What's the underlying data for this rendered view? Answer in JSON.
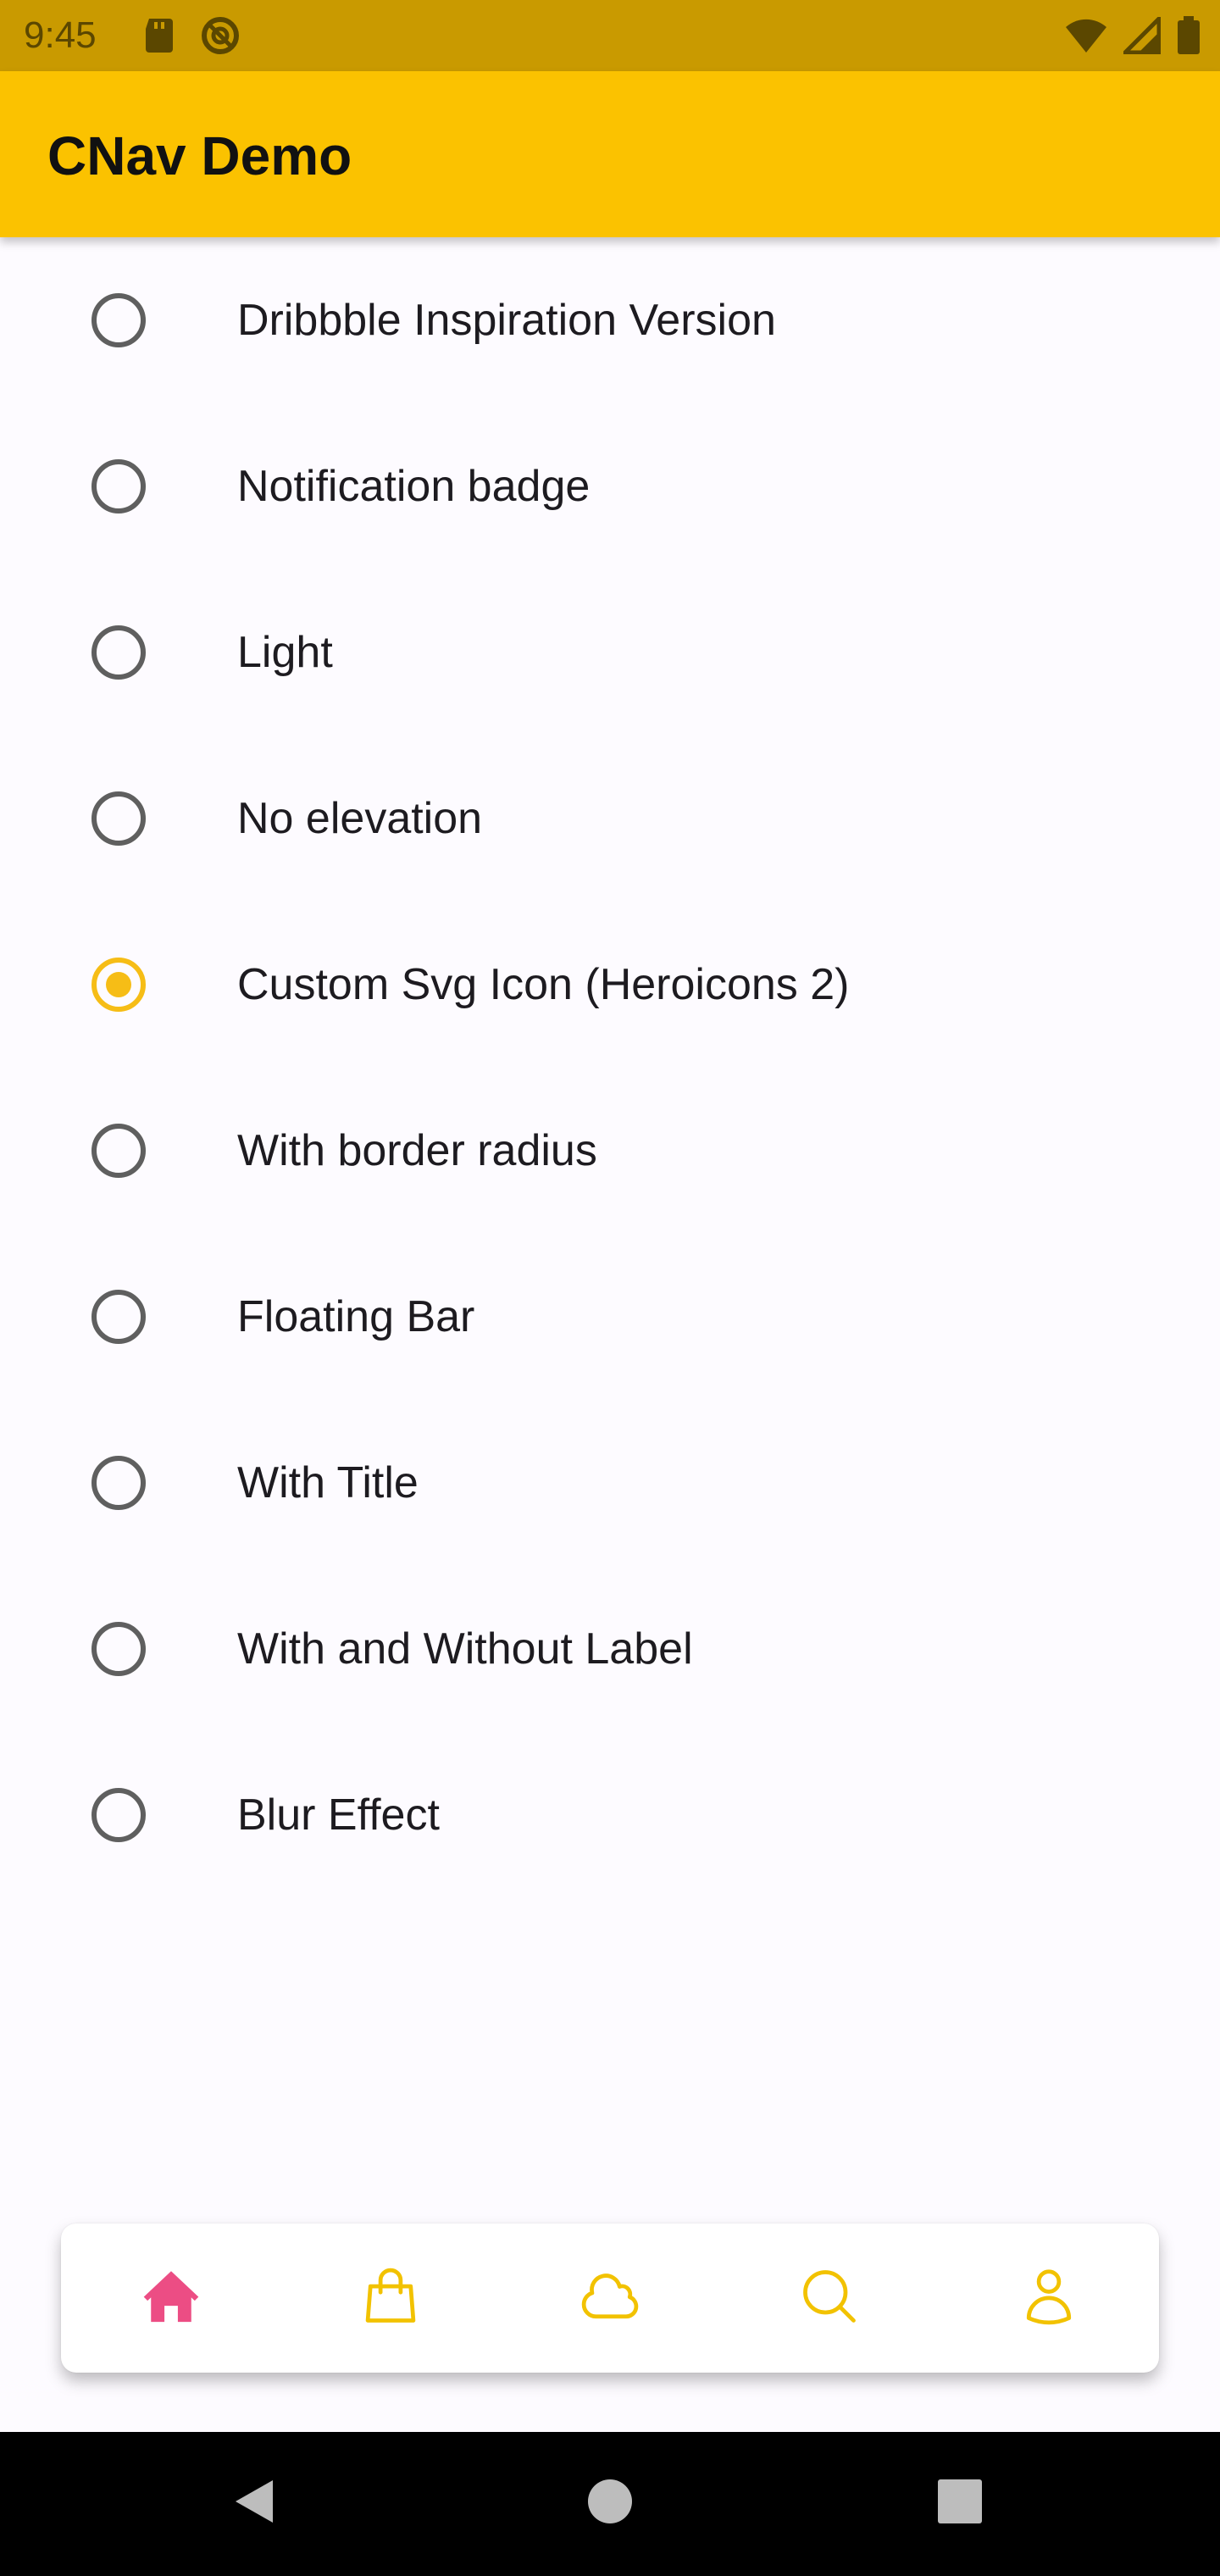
{
  "status_bar": {
    "time": "9:45",
    "icons": [
      "sd-card-icon",
      "do-not-disturb-icon",
      "wifi-icon",
      "cellular-signal-icon",
      "battery-icon"
    ]
  },
  "app_bar": {
    "title": "CNav Demo",
    "color": "#fbc200"
  },
  "options": {
    "selected_index": 4,
    "items": [
      {
        "label": "Dribbble Inspiration Version",
        "selected": false
      },
      {
        "label": "Notification badge",
        "selected": false
      },
      {
        "label": "Light",
        "selected": false
      },
      {
        "label": "No elevation",
        "selected": false
      },
      {
        "label": "Custom Svg Icon (Heroicons 2)",
        "selected": true
      },
      {
        "label": "With border radius",
        "selected": false
      },
      {
        "label": "Floating Bar",
        "selected": false
      },
      {
        "label": "With Title",
        "selected": false
      },
      {
        "label": "With and Without Label",
        "selected": false
      },
      {
        "label": "Blur Effect",
        "selected": false
      }
    ],
    "selected_color": "#f6bd16"
  },
  "bottom_nav": {
    "active_index": 0,
    "active_color": "#ec4d84",
    "inactive_color": "#f2c200",
    "items": [
      {
        "icon": "home-icon"
      },
      {
        "icon": "shopping-bag-icon"
      },
      {
        "icon": "cloud-icon"
      },
      {
        "icon": "search-icon"
      },
      {
        "icon": "user-icon"
      }
    ]
  },
  "system_nav": {
    "icons": [
      "back-icon",
      "home-circle-icon",
      "recents-icon"
    ]
  }
}
